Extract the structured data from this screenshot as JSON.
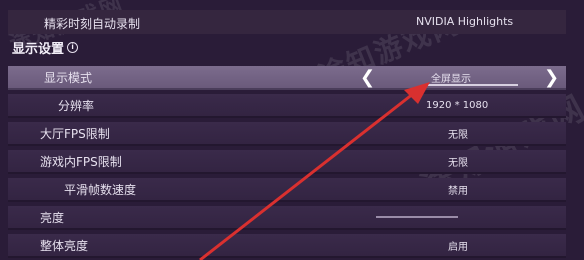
{
  "top": {
    "label": "精彩时刻自动录制",
    "value": "NVIDIA Highlights"
  },
  "section": {
    "title": "显示设置",
    "info_icon": "info-icon"
  },
  "rows": [
    {
      "label": "显示模式",
      "value": "全屏显示"
    },
    {
      "label": "分辨率",
      "value": "1920 * 1080"
    },
    {
      "label": "大厅FPS限制",
      "value": "无限"
    },
    {
      "label": "游戏内FPS限制",
      "value": "无限"
    },
    {
      "label": "平滑帧数速度",
      "value": "禁用"
    },
    {
      "label": "亮度",
      "value": ""
    },
    {
      "label": "整体亮度",
      "value": "启用"
    }
  ],
  "watermark": "途知游戏网",
  "colors": {
    "background": "#2a1c38",
    "row": "#3a2a4a",
    "selected_row": "#7c6c8d",
    "arrow": "#d9302f"
  }
}
